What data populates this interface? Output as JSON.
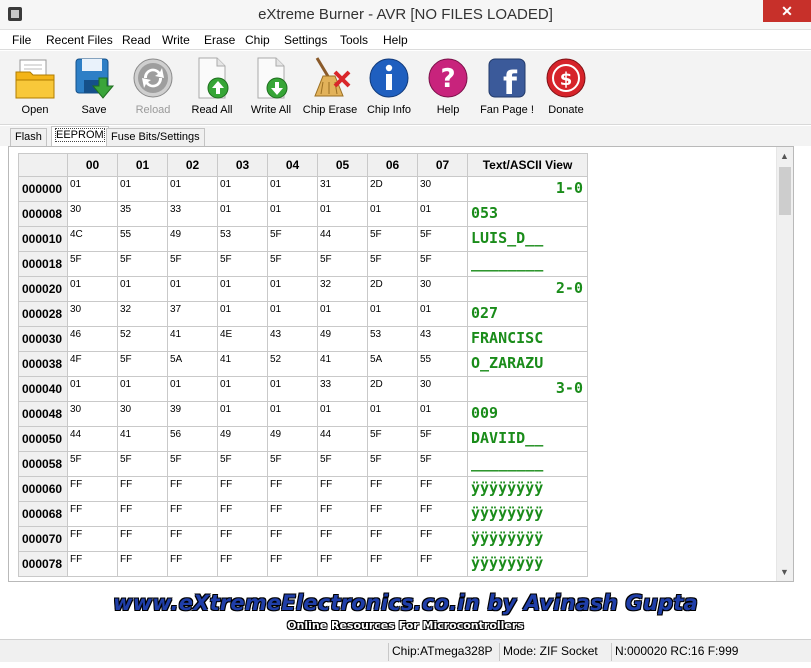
{
  "window": {
    "title": "eXtreme Burner - AVR [NO FILES LOADED]",
    "close_glyph": "✕"
  },
  "menu": [
    "File",
    "Recent Files",
    "Read",
    "Write",
    "Erase",
    "Chip",
    "Settings",
    "Tools",
    "Help"
  ],
  "toolbar": [
    {
      "label": "Open",
      "icon": "folder-icon",
      "enabled": true
    },
    {
      "label": "Save",
      "icon": "save-icon",
      "enabled": true
    },
    {
      "label": "Reload",
      "icon": "reload-icon",
      "enabled": false
    },
    {
      "label": "Read All",
      "icon": "read-all-icon",
      "enabled": true
    },
    {
      "label": "Write All",
      "icon": "write-all-icon",
      "enabled": true
    },
    {
      "label": "Chip Erase",
      "icon": "chip-erase-icon",
      "enabled": true
    },
    {
      "label": "Chip Info",
      "icon": "chip-info-icon",
      "enabled": true
    },
    {
      "label": "Help",
      "icon": "help-icon",
      "enabled": true
    },
    {
      "label": "Fan Page !",
      "icon": "facebook-icon",
      "enabled": true
    },
    {
      "label": "Donate",
      "icon": "donate-icon",
      "enabled": true
    }
  ],
  "tabs": [
    {
      "label": "Flash",
      "active": false
    },
    {
      "label": "EEPROM",
      "active": true
    },
    {
      "label": "Fuse Bits/Settings",
      "active": false
    }
  ],
  "grid": {
    "columns": [
      "00",
      "01",
      "02",
      "03",
      "04",
      "05",
      "06",
      "07"
    ],
    "ascii_header": "Text/ASCII View",
    "rows": [
      {
        "addr": "000000",
        "bytes": [
          "01",
          "01",
          "01",
          "01",
          "01",
          "31",
          "2D",
          "30"
        ],
        "ascii": "1-0",
        "align": "right"
      },
      {
        "addr": "000008",
        "bytes": [
          "30",
          "35",
          "33",
          "01",
          "01",
          "01",
          "01",
          "01"
        ],
        "ascii": "053",
        "align": "left"
      },
      {
        "addr": "000010",
        "bytes": [
          "4C",
          "55",
          "49",
          "53",
          "5F",
          "44",
          "5F",
          "5F"
        ],
        "ascii": "LUIS_D__",
        "align": "left"
      },
      {
        "addr": "000018",
        "bytes": [
          "5F",
          "5F",
          "5F",
          "5F",
          "5F",
          "5F",
          "5F",
          "5F"
        ],
        "ascii": "________",
        "align": "left"
      },
      {
        "addr": "000020",
        "bytes": [
          "01",
          "01",
          "01",
          "01",
          "01",
          "32",
          "2D",
          "30"
        ],
        "ascii": "2-0",
        "align": "right"
      },
      {
        "addr": "000028",
        "bytes": [
          "30",
          "32",
          "37",
          "01",
          "01",
          "01",
          "01",
          "01"
        ],
        "ascii": "027",
        "align": "left"
      },
      {
        "addr": "000030",
        "bytes": [
          "46",
          "52",
          "41",
          "4E",
          "43",
          "49",
          "53",
          "43"
        ],
        "ascii": "FRANCISC",
        "align": "left"
      },
      {
        "addr": "000038",
        "bytes": [
          "4F",
          "5F",
          "5A",
          "41",
          "52",
          "41",
          "5A",
          "55"
        ],
        "ascii": "O_ZARAZU",
        "align": "left"
      },
      {
        "addr": "000040",
        "bytes": [
          "01",
          "01",
          "01",
          "01",
          "01",
          "33",
          "2D",
          "30"
        ],
        "ascii": "3-0",
        "align": "right"
      },
      {
        "addr": "000048",
        "bytes": [
          "30",
          "30",
          "39",
          "01",
          "01",
          "01",
          "01",
          "01"
        ],
        "ascii": "009",
        "align": "left"
      },
      {
        "addr": "000050",
        "bytes": [
          "44",
          "41",
          "56",
          "49",
          "49",
          "44",
          "5F",
          "5F"
        ],
        "ascii": "DAVIID__",
        "align": "left"
      },
      {
        "addr": "000058",
        "bytes": [
          "5F",
          "5F",
          "5F",
          "5F",
          "5F",
          "5F",
          "5F",
          "5F"
        ],
        "ascii": "________",
        "align": "left"
      },
      {
        "addr": "000060",
        "bytes": [
          "FF",
          "FF",
          "FF",
          "FF",
          "FF",
          "FF",
          "FF",
          "FF"
        ],
        "ascii": "ÿÿÿÿÿÿÿÿ",
        "align": "left"
      },
      {
        "addr": "000068",
        "bytes": [
          "FF",
          "FF",
          "FF",
          "FF",
          "FF",
          "FF",
          "FF",
          "FF"
        ],
        "ascii": "ÿÿÿÿÿÿÿÿ",
        "align": "left"
      },
      {
        "addr": "000070",
        "bytes": [
          "FF",
          "FF",
          "FF",
          "FF",
          "FF",
          "FF",
          "FF",
          "FF"
        ],
        "ascii": "ÿÿÿÿÿÿÿÿ",
        "align": "left"
      },
      {
        "addr": "000078",
        "bytes": [
          "FF",
          "FF",
          "FF",
          "FF",
          "FF",
          "FF",
          "FF",
          "FF"
        ],
        "ascii": "ÿÿÿÿÿÿÿÿ",
        "align": "left"
      }
    ]
  },
  "banner": {
    "main": "www.eXtremeElectronics.co.in by Avinash Gupta",
    "sub": "Online Resources For Microcontrollers"
  },
  "status": {
    "chip": "Chip:ATmega328P",
    "mode": "Mode: ZIF Socket",
    "info": "N:000020 RC:16 F:999"
  },
  "colors": {
    "ascii_text": "#1a8c1a",
    "banner_text": "#1f3ea8",
    "close_button": "#c7302a"
  }
}
